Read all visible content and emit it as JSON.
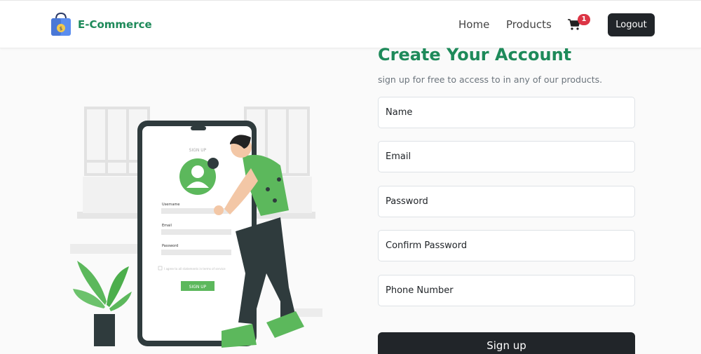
{
  "brand": {
    "name": "E-Commerce",
    "logo_icon": "shopping-bag-icon"
  },
  "nav": {
    "home": "Home",
    "products": "Products",
    "cart_icon": "cart-icon",
    "cart_count": "1",
    "logout": "Logout"
  },
  "illustration": {
    "phone_title": "SIGN UP",
    "username_label": "Username",
    "email_label": "Email",
    "password_label": "Password",
    "agree_text": "I agree to all statements in terms of service",
    "button": "SIGN UP"
  },
  "form": {
    "title": "Create Your Account",
    "subtitle": "sign up for free to access to in any of our products.",
    "name_placeholder": "Name",
    "email_placeholder": "Email",
    "password_placeholder": "Password",
    "confirm_placeholder": "Confirm Password",
    "phone_placeholder": "Phone Number",
    "submit": "Sign up"
  },
  "colors": {
    "brand_green": "#1e8a5a",
    "accent_green": "#5cb85c",
    "dark": "#212529",
    "badge_red": "#dc3545"
  }
}
